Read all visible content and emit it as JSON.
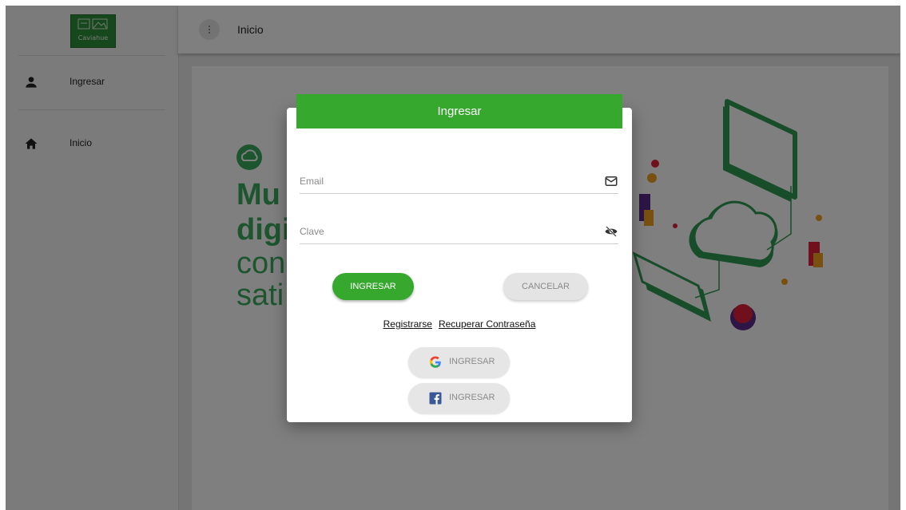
{
  "sidebar": {
    "logo_text": "Caviahue",
    "items": [
      {
        "label": "Ingresar",
        "icon": "person-icon"
      },
      {
        "label": "Inicio",
        "icon": "home-icon"
      }
    ]
  },
  "header": {
    "title": "Inicio",
    "menu_icon": "more-vert-icon"
  },
  "hero": {
    "line1": "Mu",
    "line2": "digi",
    "line3": "con",
    "line4": "sati"
  },
  "modal": {
    "title": "Ingresar",
    "email_placeholder": "Email",
    "password_placeholder": "Clave",
    "login_label": "INGRESAR",
    "cancel_label": "CANCELAR",
    "register_link": "Registrarse",
    "recover_link": "Recuperar Contraseña",
    "google_label": "INGRESAR",
    "facebook_label": "INGRESAR"
  },
  "colors": {
    "primary_green": "#36a82e",
    "hero_green": "#3aaa5c"
  }
}
